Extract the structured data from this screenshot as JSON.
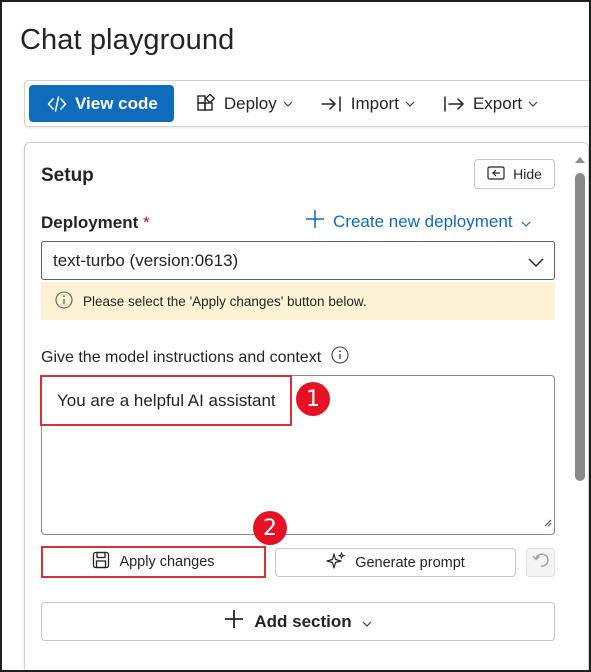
{
  "page": {
    "title": "Chat playground"
  },
  "toolbar": {
    "view_code": "View code",
    "deploy": "Deploy",
    "import": "Import",
    "export": "Export"
  },
  "setup": {
    "title": "Setup",
    "hide_label": "Hide",
    "deployment_label": "Deployment",
    "required_mark": "*",
    "create_link": "Create new deployment",
    "deployment_value": "text-turbo (version:0613)",
    "warning": "Please select the 'Apply changes' button below.",
    "instructions_label": "Give the model instructions and context",
    "system_message": "You are a helpful AI assistant",
    "apply_changes": "Apply changes",
    "generate_prompt": "Generate prompt",
    "add_section": "Add section"
  },
  "annotations": {
    "step1": "1",
    "step2": "2"
  },
  "colors": {
    "accent": "#0f6cbd",
    "highlight": "#d13438",
    "badge": "#e81123",
    "warning_bg": "#fdf3d4"
  }
}
